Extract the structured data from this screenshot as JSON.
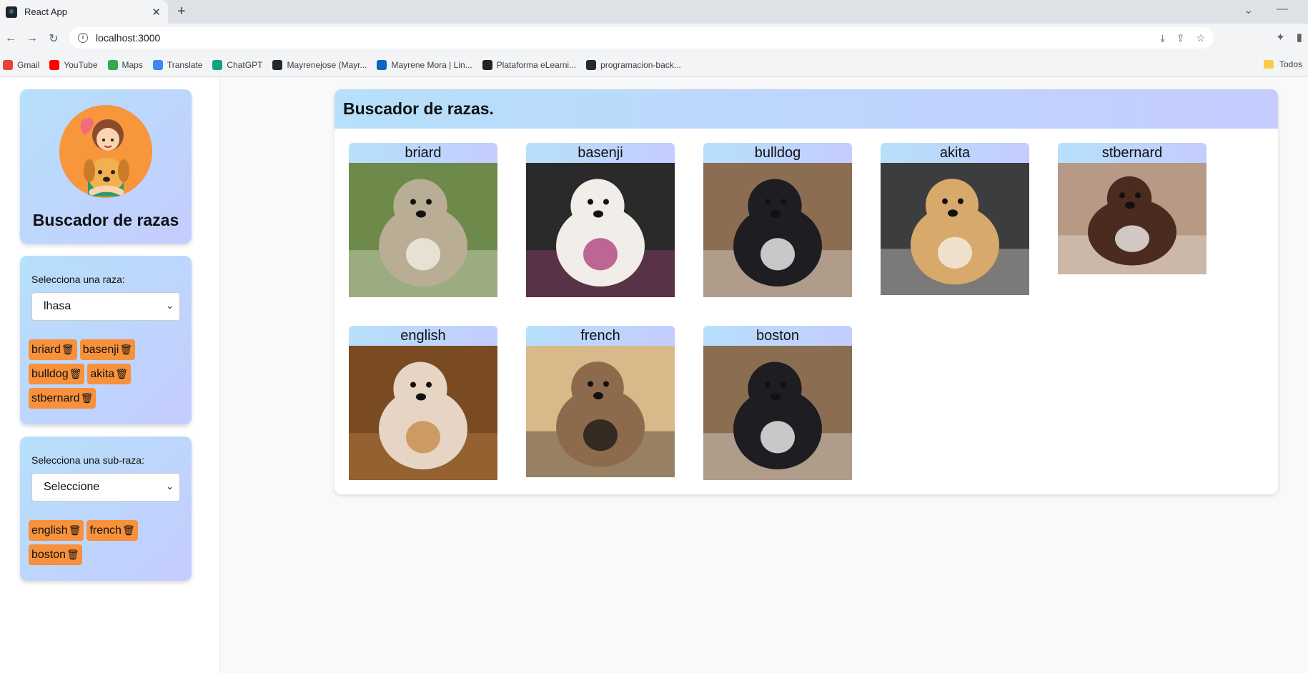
{
  "browser": {
    "tab_title": "React App",
    "url": "localhost:3000",
    "bookmarks": [
      {
        "label": "Gmail",
        "color": "#ea4335"
      },
      {
        "label": "YouTube",
        "color": "#ff0000"
      },
      {
        "label": "Maps",
        "color": "#34a853"
      },
      {
        "label": "Translate",
        "color": "#4285f4"
      },
      {
        "label": "ChatGPT",
        "color": "#10a37f"
      },
      {
        "label": "Mayrenejose (Mayr...",
        "color": "#24292f"
      },
      {
        "label": "Mayrene Mora | Lin...",
        "color": "#0a66c2"
      },
      {
        "label": "Plataforma eLearni...",
        "color": "#222222"
      },
      {
        "label": "programacion-back...",
        "color": "#24292f"
      }
    ],
    "bookmarks_folder": "Todos"
  },
  "sidebar": {
    "profile_title": "Buscador de razas",
    "breed_select": {
      "label": "Selecciona una raza:",
      "value": "lhasa",
      "chips": [
        "briard",
        "basenji",
        "bulldog",
        "akita",
        "stbernard"
      ]
    },
    "subbreed_select": {
      "label": "Selecciona una sub-raza:",
      "value": "Seleccione",
      "chips": [
        "english",
        "french",
        "boston"
      ]
    }
  },
  "main": {
    "title": "Buscador de razas.",
    "dogs": [
      {
        "name": "briard"
      },
      {
        "name": "basenji"
      },
      {
        "name": "bulldog"
      },
      {
        "name": "akita"
      },
      {
        "name": "stbernard"
      },
      {
        "name": "english"
      },
      {
        "name": "french"
      },
      {
        "name": "boston"
      }
    ]
  }
}
